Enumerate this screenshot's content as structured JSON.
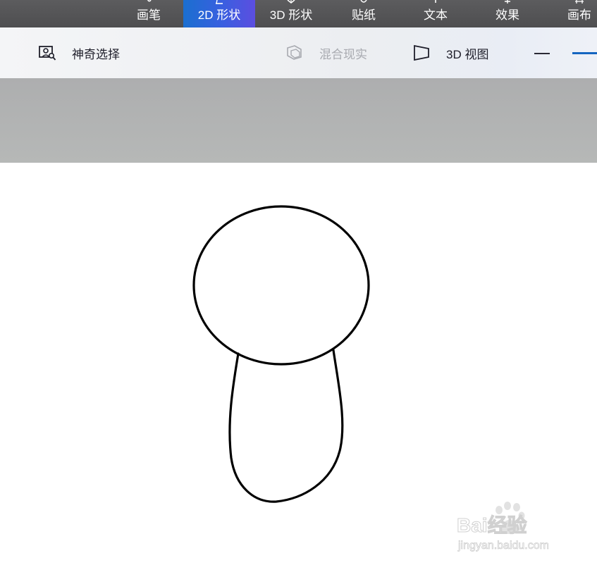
{
  "ribbon": {
    "tabs": [
      {
        "label": "画笔",
        "icon": "brush-icon",
        "active": false
      },
      {
        "label": "2D 形状",
        "icon": "2d-shapes-icon",
        "active": true
      },
      {
        "label": "3D 形状",
        "icon": "3d-shapes-icon",
        "active": false
      },
      {
        "label": "贴纸",
        "icon": "stickers-icon",
        "active": false
      },
      {
        "label": "文本",
        "icon": "text-icon",
        "active": false
      },
      {
        "label": "效果",
        "icon": "effects-icon",
        "active": false
      },
      {
        "label": "画布",
        "icon": "canvas-icon",
        "active": false
      }
    ],
    "active_color": "#3a5fe0",
    "background_color": "#555557"
  },
  "toolbar": {
    "magic_select": {
      "label": "神奇选择",
      "icon": "magic-select-icon"
    },
    "mixed_reality": {
      "label": "混合现实",
      "icon": "mixed-reality-icon",
      "disabled": true
    },
    "view_3d": {
      "label": "3D 视图",
      "icon": "3d-view-icon"
    },
    "zoom_control": {
      "icon": "zoom-out-icon",
      "accent": "#1565c0"
    }
  },
  "canvas": {
    "background": "#ffffff",
    "drawing": {
      "head": "ellipse",
      "body": "rounded-outline",
      "stroke": "#000000"
    }
  },
  "watermark": {
    "logo_text": "Bai经验",
    "url_text": "jingyan.baidu.com"
  }
}
